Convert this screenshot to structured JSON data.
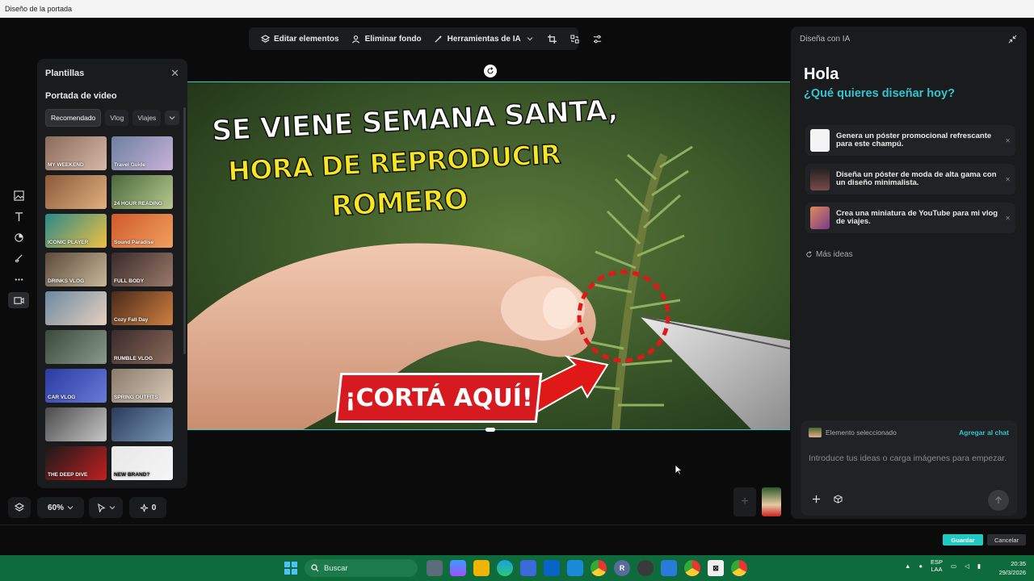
{
  "window": {
    "title": "Diseño de la portada"
  },
  "toolbar": {
    "edit_label": "Editar elementos",
    "remove_bg_label": "Eliminar fondo",
    "ai_tools_label": "Herramientas de IA"
  },
  "templates": {
    "title": "Plantillas",
    "section": "Portada de video",
    "chips": [
      "Recomendado",
      "Vlog",
      "Viajes"
    ],
    "thumbs": [
      {
        "label": "MY WEEKEND",
        "colors": [
          "#8a6a5a",
          "#d8b8a8"
        ]
      },
      {
        "label": "Travel Guide",
        "colors": [
          "#6d7fa0",
          "#c9b4d8"
        ]
      },
      {
        "label": "",
        "colors": [
          "#8a5a3a",
          "#e0b080"
        ]
      },
      {
        "label": "24 HOUR READING",
        "colors": [
          "#4a6a3a",
          "#b8c890"
        ]
      },
      {
        "label": "ICONIC PLAYER",
        "colors": [
          "#2a8a8a",
          "#f0c040"
        ]
      },
      {
        "label": "Sound Paradise",
        "colors": [
          "#d05a2a",
          "#f0a060"
        ]
      },
      {
        "label": "DRINKS VLOG",
        "colors": [
          "#5a4a3a",
          "#c8b898"
        ]
      },
      {
        "label": "FULL BODY",
        "colors": [
          "#3a2a2a",
          "#9a7a6a"
        ]
      },
      {
        "label": "",
        "colors": [
          "#6a8aa0",
          "#e8d0c0"
        ]
      },
      {
        "label": "Cozy Fall Day",
        "colors": [
          "#4a2a1a",
          "#d08040"
        ]
      },
      {
        "label": "",
        "colors": [
          "#3a4a3a",
          "#8a9a8a"
        ]
      },
      {
        "label": "RUMBLE VLOG",
        "colors": [
          "#3a2a2a",
          "#8a6a5a"
        ]
      },
      {
        "label": "CAR VLOG",
        "colors": [
          "#2a3aa0",
          "#6a7ad8"
        ]
      },
      {
        "label": "SPRING OUTFITS",
        "colors": [
          "#8a7a6a",
          "#d8c8b8"
        ]
      },
      {
        "label": "",
        "colors": [
          "#4a4a4a",
          "#c8c8c8"
        ]
      },
      {
        "label": "",
        "colors": [
          "#2a3a5a",
          "#7a9ab8"
        ]
      },
      {
        "label": "THE DEEP DIVE",
        "colors": [
          "#1a1a1a",
          "#c02020"
        ]
      },
      {
        "label": "NEW BRAND?",
        "colors": [
          "#e8e8e8",
          "#f5f5f5"
        ]
      }
    ]
  },
  "zoom": {
    "value": "60%",
    "count": "0"
  },
  "canvas": {
    "line1": "SE VIENE SEMANA SANTA,",
    "line2": "HORA DE REPRODUCIR",
    "line3": "ROMERO",
    "cta": "¡CORTÁ AQUÍ!"
  },
  "ai_panel": {
    "title": "Diseña con IA",
    "greeting": "Hola",
    "question": "¿Qué quieres diseñar hoy?",
    "suggestions": [
      {
        "text": "Genera un póster promocional refrescante para este champú.",
        "color": "#f4f4f4"
      },
      {
        "text": "Diseña un póster de moda de alta gama con un diseño minimalista.",
        "color": "#3a2a2a"
      },
      {
        "text": "Crea una miniatura de YouTube para mi vlog de viajes.",
        "color": "#d07a5a"
      }
    ],
    "more_ideas": "Más ideas",
    "selected_label": "Elemento seleccionado",
    "add_to_chat": "Agregar al chat",
    "input_placeholder": "Introduce tus ideas o carga imágenes para empezar."
  },
  "footer": {
    "save": "Guardar",
    "cancel": "Cancelar"
  },
  "taskbar": {
    "search_label": "Buscar",
    "lang_line1": "ESP",
    "lang_line2": "LAA",
    "time": "20:35",
    "date": "29/3/2026"
  }
}
